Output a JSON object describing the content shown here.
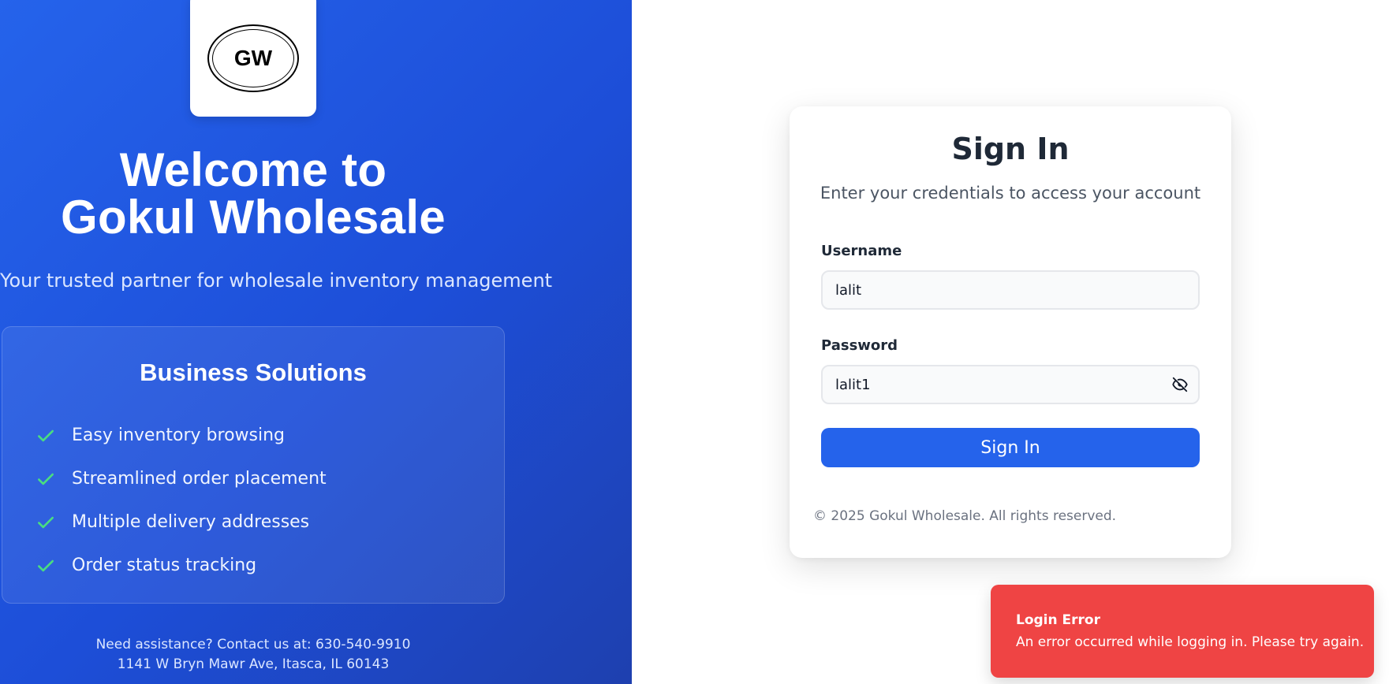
{
  "brand": {
    "logo_text": "GW",
    "welcome_line1": "Welcome to",
    "welcome_line2": "Gokul Wholesale",
    "tagline": "Your trusted partner for wholesale inventory management"
  },
  "solutions": {
    "title": "Business Solutions",
    "items": [
      {
        "label": "Easy inventory browsing",
        "icon": "check-icon"
      },
      {
        "label": "Streamlined order placement",
        "icon": "check-icon"
      },
      {
        "label": "Multiple delivery addresses",
        "icon": "check-icon"
      },
      {
        "label": "Order status tracking",
        "icon": "check-icon"
      }
    ]
  },
  "contact": {
    "line1": "Need assistance? Contact us at: 630-540-9910",
    "line2": "1141 W Bryn Mawr Ave, Itasca, IL 60143"
  },
  "signin": {
    "title": "Sign In",
    "subtitle": "Enter your credentials to access your account",
    "username_label": "Username",
    "username_value": "lalit",
    "password_label": "Password",
    "password_value": "lalit1",
    "password_toggle_icon": "eye-off-icon",
    "button_label": "Sign In",
    "copyright": "© 2025 Gokul Wholesale. All rights reserved."
  },
  "toast": {
    "title": "Login Error",
    "message": "An error occurred while logging in. Please try again."
  },
  "colors": {
    "brand_blue": "#2563eb",
    "brand_blue_dark": "#1e40af",
    "check_green": "#4ade80",
    "error_red": "#ef4444",
    "heading": "#1f2937"
  }
}
